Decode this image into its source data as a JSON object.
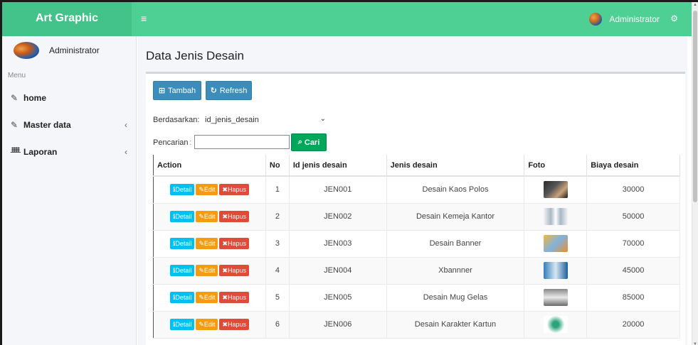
{
  "header": {
    "brand": "Art Graphic",
    "menu_toggle": "≡",
    "user_name": "Administrator",
    "settings_icon": "gears-icon"
  },
  "sidebar": {
    "user_name": "Administrator",
    "menu_label": "Menu",
    "items": [
      {
        "label": "home",
        "icon": "edit-icon",
        "chevron": ""
      },
      {
        "label": "Master data",
        "icon": "edit-icon",
        "chevron": "‹"
      },
      {
        "label": "Laporan",
        "icon": "sitemap-icon",
        "chevron": "‹"
      }
    ]
  },
  "page": {
    "title": "Data Jenis Desain"
  },
  "toolbar": {
    "tambah_label": "Tambah",
    "refresh_label": "Refresh"
  },
  "filter": {
    "berdasarkan_label": "Berdasarkan:",
    "select_value": "id_jenis_desain",
    "pencarian_label": "Pencarian",
    "colon": ":",
    "search_value": "",
    "cari_label": "Cari"
  },
  "table": {
    "headers": [
      "Action",
      "No",
      "Id jenis desain",
      "Jenis desain",
      "Foto",
      "Biaya desain"
    ],
    "action_labels": {
      "detail": "Detail",
      "edit": "Edit",
      "hapus": "Hapus"
    },
    "rows": [
      {
        "no": "1",
        "id": "JEN001",
        "jenis": "Desain Kaos Polos",
        "foto": "tshirt-photo",
        "biaya": "30000"
      },
      {
        "no": "2",
        "id": "JEN002",
        "jenis": "Desain Kemeja Kantor",
        "foto": "shirt-photo",
        "biaya": "50000"
      },
      {
        "no": "3",
        "id": "JEN003",
        "jenis": "Desain Banner",
        "foto": "banner-photo",
        "biaya": "70000"
      },
      {
        "no": "4",
        "id": "JEN004",
        "jenis": "Xbannner",
        "foto": "xbanner-photo",
        "biaya": "45000"
      },
      {
        "no": "5",
        "id": "JEN005",
        "jenis": "Desain Mug Gelas",
        "foto": "mug-photo",
        "biaya": "85000"
      },
      {
        "no": "6",
        "id": "JEN006",
        "jenis": "Desain Karakter Kartun",
        "foto": "cartoon-photo",
        "biaya": "20000"
      }
    ]
  },
  "colors": {
    "topbar": "#4ecf94",
    "brand_bg": "#43c389",
    "primary_button": "#3c8dbc",
    "search_button": "#00a65a",
    "detail": "#00c0ef",
    "edit": "#f39c12",
    "hapus": "#dd4b39"
  }
}
